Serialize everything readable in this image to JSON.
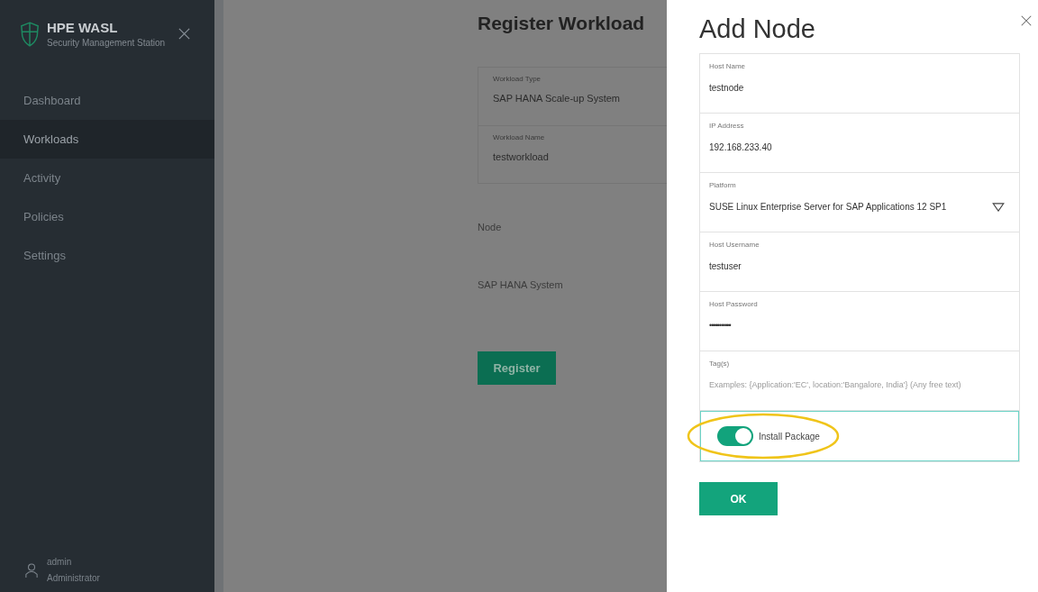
{
  "sidebar": {
    "brand": "HPE WASL",
    "subtitle": "Security Management Station",
    "items": [
      {
        "label": "Dashboard",
        "selected": false
      },
      {
        "label": "Workloads",
        "selected": true
      },
      {
        "label": "Activity",
        "selected": false
      },
      {
        "label": "Policies",
        "selected": false
      },
      {
        "label": "Settings",
        "selected": false
      }
    ],
    "user": {
      "name": "admin",
      "role": "Administrator"
    }
  },
  "main": {
    "title": "Register Workload",
    "fields": [
      {
        "label": "Workload Type",
        "value": "SAP HANA Scale-up System"
      },
      {
        "label": "Workload Name",
        "value": "testworkload"
      }
    ],
    "sections": [
      "Node",
      "SAP HANA System"
    ],
    "button": "Register"
  },
  "panel": {
    "title": "Add Node",
    "fields": [
      {
        "kind": "text",
        "label": "Host Name",
        "value": "testnode"
      },
      {
        "kind": "text",
        "label": "IP Address",
        "value": "192.168.233.40"
      },
      {
        "kind": "select",
        "label": "Platform",
        "value": "SUSE Linux Enterprise Server for SAP Applications 12 SP1"
      },
      {
        "kind": "text",
        "label": "Host Username",
        "value": "testuser"
      },
      {
        "kind": "password",
        "label": "Host Password",
        "value": "•••••••••••"
      },
      {
        "kind": "text",
        "label": "Tag(s)",
        "placeholder": "Examples: {Application:'EC', location:'Bangalore, India'} (Any free text)"
      }
    ],
    "toggle": {
      "label": "Install Package",
      "on": true
    },
    "button": "OK"
  }
}
